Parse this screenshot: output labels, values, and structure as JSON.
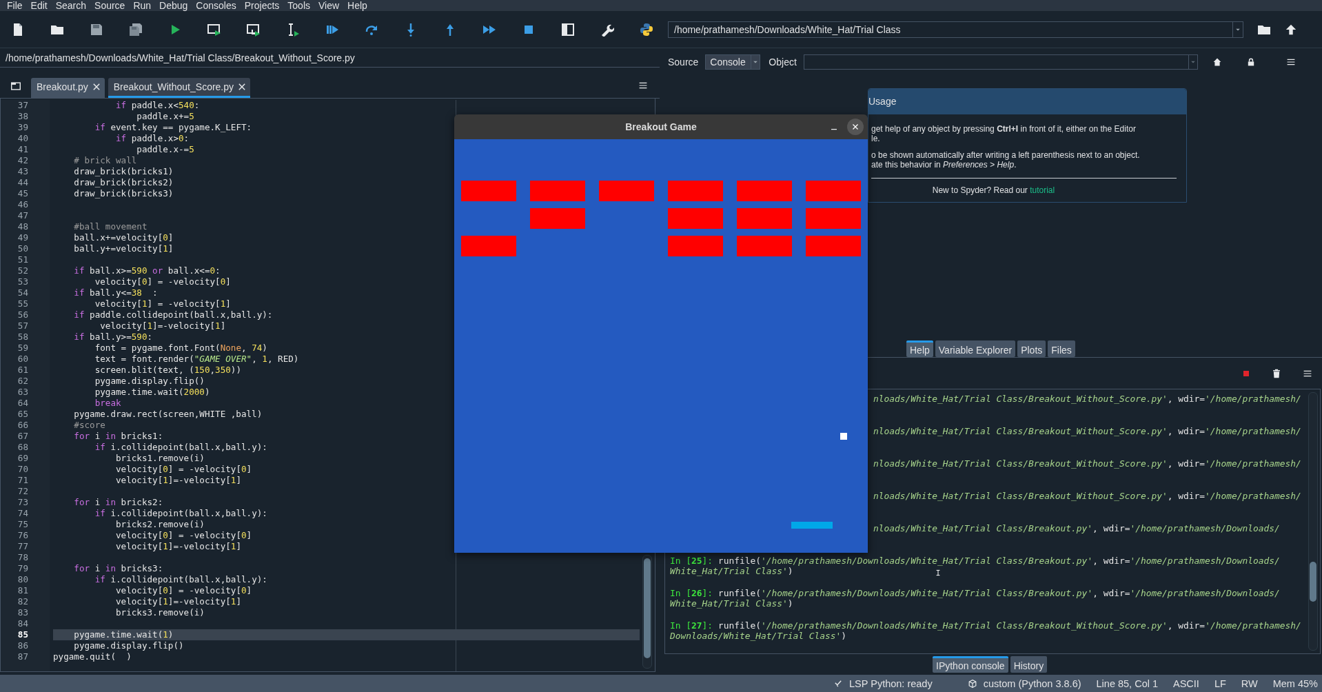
{
  "menu": [
    "File",
    "Edit",
    "Search",
    "Source",
    "Run",
    "Debug",
    "Consoles",
    "Projects",
    "Tools",
    "View",
    "Help"
  ],
  "working_directory": "/home/prathamesh/Downloads/White_Hat/Trial Class",
  "editor": {
    "file_path": "/home/prathamesh/Downloads/White_Hat/Trial Class/Breakout_Without_Score.py",
    "tabs": [
      {
        "label": "Breakout.py",
        "selected": false
      },
      {
        "label": "Breakout_Without_Score.py",
        "selected": true
      }
    ],
    "lines": [
      {
        "number": "37",
        "current": false,
        "tokens": [
          {
            "kind": "kw",
            "text": "            if"
          },
          {
            "kind": "plain",
            "text": " paddle.x<"
          },
          {
            "kind": "num",
            "text": "540"
          },
          {
            "kind": "plain",
            "text": ":"
          }
        ]
      },
      {
        "number": "38",
        "current": false,
        "tokens": [
          {
            "kind": "plain",
            "text": "                paddle.x+="
          },
          {
            "kind": "num",
            "text": "5"
          }
        ]
      },
      {
        "number": "39",
        "current": false,
        "tokens": [
          {
            "kind": "kw",
            "text": "        if"
          },
          {
            "kind": "plain",
            "text": " event.key == pygame.K_LEFT:"
          }
        ]
      },
      {
        "number": "40",
        "current": false,
        "tokens": [
          {
            "kind": "kw",
            "text": "            if"
          },
          {
            "kind": "plain",
            "text": " paddle.x>"
          },
          {
            "kind": "num",
            "text": "0"
          },
          {
            "kind": "plain",
            "text": ":"
          }
        ]
      },
      {
        "number": "41",
        "current": false,
        "tokens": [
          {
            "kind": "plain",
            "text": "                paddle.x-="
          },
          {
            "kind": "num",
            "text": "5"
          }
        ]
      },
      {
        "number": "42",
        "current": false,
        "tokens": [
          {
            "kind": "com",
            "text": "    # brick wall"
          }
        ]
      },
      {
        "number": "43",
        "current": false,
        "tokens": [
          {
            "kind": "plain",
            "text": "    draw_brick(bricks1)"
          }
        ]
      },
      {
        "number": "44",
        "current": false,
        "tokens": [
          {
            "kind": "plain",
            "text": "    draw_brick(bricks2)"
          }
        ]
      },
      {
        "number": "45",
        "current": false,
        "tokens": [
          {
            "kind": "plain",
            "text": "    draw_brick(bricks3)"
          }
        ]
      },
      {
        "number": "46",
        "current": false
      },
      {
        "number": "47",
        "current": false
      },
      {
        "number": "48",
        "current": false,
        "tokens": [
          {
            "kind": "com",
            "text": "    #ball movement"
          }
        ]
      },
      {
        "number": "49",
        "current": false,
        "tokens": [
          {
            "kind": "plain",
            "text": "    ball.x+=velocity["
          },
          {
            "kind": "num",
            "text": "0"
          },
          {
            "kind": "plain",
            "text": "]"
          }
        ]
      },
      {
        "number": "50",
        "current": false,
        "tokens": [
          {
            "kind": "plain",
            "text": "    ball.y+=velocity["
          },
          {
            "kind": "num",
            "text": "1"
          },
          {
            "kind": "plain",
            "text": "]"
          }
        ]
      },
      {
        "number": "51",
        "current": false
      },
      {
        "number": "52",
        "current": false,
        "tokens": [
          {
            "kind": "kw",
            "text": "    if"
          },
          {
            "kind": "plain",
            "text": " ball.x>="
          },
          {
            "kind": "num",
            "text": "590"
          },
          {
            "kind": "kw",
            "text": " or"
          },
          {
            "kind": "plain",
            "text": " ball.x<="
          },
          {
            "kind": "num",
            "text": "0"
          },
          {
            "kind": "plain",
            "text": ":"
          }
        ]
      },
      {
        "number": "53",
        "current": false,
        "tokens": [
          {
            "kind": "plain",
            "text": "        velocity["
          },
          {
            "kind": "num",
            "text": "0"
          },
          {
            "kind": "plain",
            "text": "] = -velocity["
          },
          {
            "kind": "num",
            "text": "0"
          },
          {
            "kind": "plain",
            "text": "]"
          }
        ]
      },
      {
        "number": "54",
        "current": false,
        "tokens": [
          {
            "kind": "kw",
            "text": "    if"
          },
          {
            "kind": "plain",
            "text": " ball.y<="
          },
          {
            "kind": "num",
            "text": "38"
          },
          {
            "kind": "plain",
            "text": "  :"
          }
        ]
      },
      {
        "number": "55",
        "current": false,
        "tokens": [
          {
            "kind": "plain",
            "text": "        velocity["
          },
          {
            "kind": "num",
            "text": "1"
          },
          {
            "kind": "plain",
            "text": "] = -velocity["
          },
          {
            "kind": "num",
            "text": "1"
          },
          {
            "kind": "plain",
            "text": "]"
          }
        ]
      },
      {
        "number": "56",
        "current": false,
        "tokens": [
          {
            "kind": "kw",
            "text": "    if"
          },
          {
            "kind": "plain",
            "text": " paddle.collidepoint(ball.x,ball.y):"
          }
        ]
      },
      {
        "number": "57",
        "current": false,
        "tokens": [
          {
            "kind": "plain",
            "text": "         velocity["
          },
          {
            "kind": "num",
            "text": "1"
          },
          {
            "kind": "plain",
            "text": "]=-velocity["
          },
          {
            "kind": "num",
            "text": "1"
          },
          {
            "kind": "plain",
            "text": "]"
          }
        ]
      },
      {
        "number": "58",
        "current": false,
        "tokens": [
          {
            "kind": "kw",
            "text": "    if"
          },
          {
            "kind": "plain",
            "text": " ball.y>="
          },
          {
            "kind": "num",
            "text": "590"
          },
          {
            "kind": "plain",
            "text": ":"
          }
        ]
      },
      {
        "number": "59",
        "current": false,
        "tokens": [
          {
            "kind": "plain",
            "text": "        font = pygame.font.Font("
          },
          {
            "kind": "const",
            "text": "None"
          },
          {
            "kind": "plain",
            "text": ", "
          },
          {
            "kind": "num",
            "text": "74"
          },
          {
            "kind": "plain",
            "text": ")"
          }
        ]
      },
      {
        "number": "60",
        "current": false,
        "tokens": [
          {
            "kind": "plain",
            "text": "        text = font.render("
          },
          {
            "kind": "str",
            "text": "\"GAME OVER\""
          },
          {
            "kind": "plain",
            "text": ", "
          },
          {
            "kind": "num",
            "text": "1"
          },
          {
            "kind": "plain",
            "text": ", RED)"
          }
        ]
      },
      {
        "number": "61",
        "current": false,
        "tokens": [
          {
            "kind": "plain",
            "text": "        screen.blit(text, ("
          },
          {
            "kind": "num",
            "text": "150"
          },
          {
            "kind": "plain",
            "text": ","
          },
          {
            "kind": "num",
            "text": "350"
          },
          {
            "kind": "plain",
            "text": "))"
          }
        ]
      },
      {
        "number": "62",
        "current": false,
        "tokens": [
          {
            "kind": "plain",
            "text": "        pygame.display.flip()"
          }
        ]
      },
      {
        "number": "63",
        "current": false,
        "tokens": [
          {
            "kind": "plain",
            "text": "        pygame.time.wait("
          },
          {
            "kind": "num",
            "text": "2000"
          },
          {
            "kind": "plain",
            "text": ")"
          }
        ]
      },
      {
        "number": "64",
        "current": false,
        "tokens": [
          {
            "kind": "kw",
            "text": "        break"
          }
        ]
      },
      {
        "number": "65",
        "current": false,
        "tokens": [
          {
            "kind": "plain",
            "text": "    pygame.draw.rect(screen,WHITE ,ball)"
          }
        ]
      },
      {
        "number": "66",
        "current": false,
        "tokens": [
          {
            "kind": "com",
            "text": "    #score"
          }
        ]
      },
      {
        "number": "67",
        "current": false,
        "tokens": [
          {
            "kind": "kw",
            "text": "    for"
          },
          {
            "kind": "plain",
            "text": " i "
          },
          {
            "kind": "kw",
            "text": "in"
          },
          {
            "kind": "plain",
            "text": " bricks1:"
          }
        ]
      },
      {
        "number": "68",
        "current": false,
        "tokens": [
          {
            "kind": "kw",
            "text": "        if"
          },
          {
            "kind": "plain",
            "text": " i.collidepoint(ball.x,ball.y):"
          }
        ]
      },
      {
        "number": "69",
        "current": false,
        "tokens": [
          {
            "kind": "plain",
            "text": "            bricks1.remove(i)"
          }
        ]
      },
      {
        "number": "70",
        "current": false,
        "tokens": [
          {
            "kind": "plain",
            "text": "            velocity["
          },
          {
            "kind": "num",
            "text": "0"
          },
          {
            "kind": "plain",
            "text": "] = -velocity["
          },
          {
            "kind": "num",
            "text": "0"
          },
          {
            "kind": "plain",
            "text": "]"
          }
        ]
      },
      {
        "number": "71",
        "current": false,
        "tokens": [
          {
            "kind": "plain",
            "text": "            velocity["
          },
          {
            "kind": "num",
            "text": "1"
          },
          {
            "kind": "plain",
            "text": "]=-velocity["
          },
          {
            "kind": "num",
            "text": "1"
          },
          {
            "kind": "plain",
            "text": "]"
          }
        ]
      },
      {
        "number": "72",
        "current": false
      },
      {
        "number": "73",
        "current": false,
        "tokens": [
          {
            "kind": "kw",
            "text": "    for"
          },
          {
            "kind": "plain",
            "text": " i "
          },
          {
            "kind": "kw",
            "text": "in"
          },
          {
            "kind": "plain",
            "text": " bricks2:"
          }
        ]
      },
      {
        "number": "74",
        "current": false,
        "tokens": [
          {
            "kind": "kw",
            "text": "        if"
          },
          {
            "kind": "plain",
            "text": " i.collidepoint(ball.x,ball.y):"
          }
        ]
      },
      {
        "number": "75",
        "current": false,
        "tokens": [
          {
            "kind": "plain",
            "text": "            bricks2.remove(i)"
          }
        ]
      },
      {
        "number": "76",
        "current": false,
        "tokens": [
          {
            "kind": "plain",
            "text": "            velocity["
          },
          {
            "kind": "num",
            "text": "0"
          },
          {
            "kind": "plain",
            "text": "] = -velocity["
          },
          {
            "kind": "num",
            "text": "0"
          },
          {
            "kind": "plain",
            "text": "]"
          }
        ]
      },
      {
        "number": "77",
        "current": false,
        "tokens": [
          {
            "kind": "plain",
            "text": "            velocity["
          },
          {
            "kind": "num",
            "text": "1"
          },
          {
            "kind": "plain",
            "text": "]=-velocity["
          },
          {
            "kind": "num",
            "text": "1"
          },
          {
            "kind": "plain",
            "text": "]"
          }
        ]
      },
      {
        "number": "78",
        "current": false
      },
      {
        "number": "79",
        "current": false,
        "tokens": [
          {
            "kind": "kw",
            "text": "    for"
          },
          {
            "kind": "plain",
            "text": " i "
          },
          {
            "kind": "kw",
            "text": "in"
          },
          {
            "kind": "plain",
            "text": " bricks3:"
          }
        ]
      },
      {
        "number": "80",
        "current": false,
        "tokens": [
          {
            "kind": "kw",
            "text": "        if"
          },
          {
            "kind": "plain",
            "text": " i.collidepoint(ball.x,ball.y):"
          }
        ]
      },
      {
        "number": "81",
        "current": false,
        "tokens": [
          {
            "kind": "plain",
            "text": "            velocity["
          },
          {
            "kind": "num",
            "text": "0"
          },
          {
            "kind": "plain",
            "text": "] = -velocity["
          },
          {
            "kind": "num",
            "text": "0"
          },
          {
            "kind": "plain",
            "text": "]"
          }
        ]
      },
      {
        "number": "82",
        "current": false,
        "tokens": [
          {
            "kind": "plain",
            "text": "            velocity["
          },
          {
            "kind": "num",
            "text": "1"
          },
          {
            "kind": "plain",
            "text": "]=-velocity["
          },
          {
            "kind": "num",
            "text": "1"
          },
          {
            "kind": "plain",
            "text": "]"
          }
        ]
      },
      {
        "number": "83",
        "current": false,
        "tokens": [
          {
            "kind": "plain",
            "text": "            bricks3.remove(i)"
          }
        ]
      },
      {
        "number": "84",
        "current": false
      },
      {
        "number": "85",
        "current": true,
        "tokens": [
          {
            "kind": "plain",
            "text": "    pygame.time.wait("
          },
          {
            "kind": "num",
            "text": "1"
          },
          {
            "kind": "plain",
            "text": ")"
          }
        ]
      },
      {
        "number": "86",
        "current": false,
        "tokens": [
          {
            "kind": "plain",
            "text": "    pygame.display.flip()"
          }
        ]
      },
      {
        "number": "87",
        "current": false,
        "tokens": [
          {
            "kind": "plain",
            "text": "pygame.quit(  )"
          }
        ]
      }
    ]
  },
  "help": {
    "source_label": "Source",
    "source_value": "Console",
    "object_label": "Object",
    "usage": {
      "title": "Usage",
      "paragraphs": [
        [
          "get help of any object by pressing **Ctrl+I** in front of it, either on the Editor",
          "le."
        ],
        [
          "o be shown automatically after writing a left parenthesis next to an object.",
          "ate this behavior in *Preferences > Help*."
        ]
      ],
      "footer": "New to Spyder? Read our",
      "link": "tutorial"
    },
    "tabs": [
      {
        "label": "Help",
        "selected": true
      },
      {
        "label": "Variable Explorer",
        "selected": false
      },
      {
        "label": "Plots",
        "selected": false
      },
      {
        "label": "Files",
        "selected": false
      }
    ]
  },
  "console": {
    "entries": [
      {
        "clipped": true,
        "lines": [
          [
            {
              "kind": "str",
              "text": "nloads/White_Hat/Trial Class/Breakout_Without_Score.py'"
            },
            {
              "kind": "plain",
              "text": ", wdir="
            },
            {
              "kind": "str",
              "text": "'/home/prathamesh/"
            }
          ]
        ]
      },
      {
        "clipped": true,
        "lines": [
          [
            {
              "kind": "str",
              "text": "nloads/White_Hat/Trial Class/Breakout_Without_Score.py'"
            },
            {
              "kind": "plain",
              "text": ", wdir="
            },
            {
              "kind": "str",
              "text": "'/home/prathamesh/"
            }
          ]
        ]
      },
      {
        "clipped": true,
        "lines": [
          [
            {
              "kind": "str",
              "text": "nloads/White_Hat/Trial Class/Breakout_Without_Score.py'"
            },
            {
              "kind": "plain",
              "text": ", wdir="
            },
            {
              "kind": "str",
              "text": "'/home/prathamesh/"
            }
          ]
        ]
      },
      {
        "clipped": true,
        "lines": [
          [
            {
              "kind": "str",
              "text": "nloads/White_Hat/Trial Class/Breakout_Without_Score.py'"
            },
            {
              "kind": "plain",
              "text": ", wdir="
            },
            {
              "kind": "str",
              "text": "'/home/prathamesh/"
            }
          ]
        ]
      },
      {
        "clipped": true,
        "lines": [
          [
            {
              "kind": "str",
              "text": "nloads/White_Hat/Trial Class/Breakout.py'"
            },
            {
              "kind": "plain",
              "text": ", wdir="
            },
            {
              "kind": "str",
              "text": "'/home/prathamesh/Downloads/"
            }
          ]
        ]
      },
      {
        "clipped": false,
        "lines": [
          [
            {
              "kind": "prompt",
              "text": "In ["
            },
            {
              "kind": "prompt-num",
              "text": "25"
            },
            {
              "kind": "prompt",
              "text": "]:"
            },
            {
              "kind": "plain",
              "text": " runfile("
            },
            {
              "kind": "str",
              "text": "'/home/prathamesh/Downloads/White_Hat/Trial Class/Breakout.py'"
            },
            {
              "kind": "plain",
              "text": ", wdir="
            },
            {
              "kind": "str",
              "text": "'/home/prathamesh/Downloads/"
            }
          ],
          [
            {
              "kind": "str",
              "text": "White_Hat/Trial Class'"
            },
            {
              "kind": "plain",
              "text": ")"
            }
          ]
        ]
      },
      {
        "clipped": false,
        "lines": [
          [
            {
              "kind": "prompt",
              "text": "In ["
            },
            {
              "kind": "prompt-num",
              "text": "26"
            },
            {
              "kind": "prompt",
              "text": "]:"
            },
            {
              "kind": "plain",
              "text": " runfile("
            },
            {
              "kind": "str",
              "text": "'/home/prathamesh/Downloads/White_Hat/Trial Class/Breakout.py'"
            },
            {
              "kind": "plain",
              "text": ", wdir="
            },
            {
              "kind": "str",
              "text": "'/home/prathamesh/Downloads/"
            }
          ],
          [
            {
              "kind": "str",
              "text": "White_Hat/Trial Class'"
            },
            {
              "kind": "plain",
              "text": ")"
            }
          ]
        ]
      },
      {
        "clipped": false,
        "lines": [
          [
            {
              "kind": "prompt",
              "text": "In ["
            },
            {
              "kind": "prompt-num",
              "text": "27"
            },
            {
              "kind": "prompt",
              "text": "]:"
            },
            {
              "kind": "plain",
              "text": " runfile("
            },
            {
              "kind": "str",
              "text": "'/home/prathamesh/Downloads/White_Hat/Trial Class/Breakout_Without_Score.py'"
            },
            {
              "kind": "plain",
              "text": ", wdir="
            },
            {
              "kind": "str",
              "text": "'/home/prathamesh/"
            }
          ],
          [
            {
              "kind": "str",
              "text": "Downloads/White_Hat/Trial Class'"
            },
            {
              "kind": "plain",
              "text": ")"
            }
          ]
        ]
      }
    ],
    "tabs": [
      {
        "label": "IPython console",
        "selected": true
      },
      {
        "label": "History",
        "selected": false
      }
    ]
  },
  "game": {
    "title": "Breakout Game",
    "brick_rows": [
      {
        "bricks": [
          {
            "present": true
          },
          {
            "present": true
          },
          {
            "present": true
          },
          {
            "present": true
          },
          {
            "present": true
          },
          {
            "present": true
          }
        ]
      },
      {
        "bricks": [
          {
            "present": false
          },
          {
            "present": true
          },
          {
            "present": false
          },
          {
            "present": true
          },
          {
            "present": true
          },
          {
            "present": true
          }
        ]
      },
      {
        "bricks": [
          {
            "present": true
          },
          {
            "present": false
          },
          {
            "present": false
          },
          {
            "present": true
          },
          {
            "present": true
          },
          {
            "present": true
          }
        ]
      }
    ]
  },
  "status_bar": {
    "lsp": "LSP Python: ready",
    "interpreter": "custom (Python 3.8.6)",
    "cursor": "Line 85, Col 1",
    "encoding": "ASCII",
    "eol": "LF",
    "permissions": "RW",
    "memory": "Mem 45%"
  }
}
